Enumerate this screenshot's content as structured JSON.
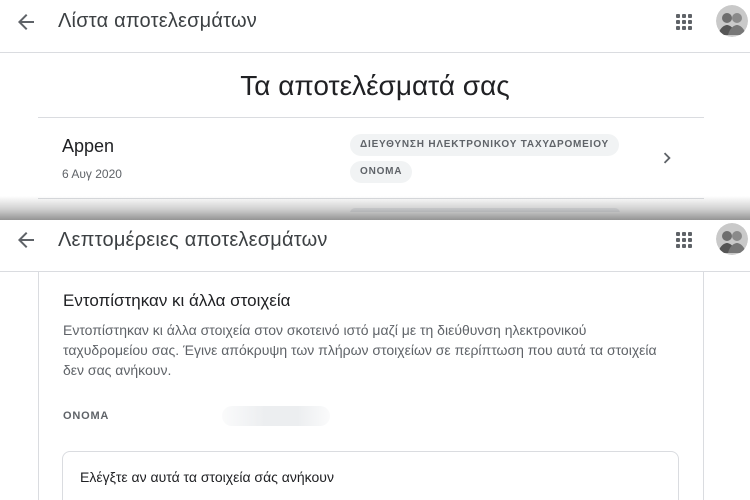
{
  "list_screen": {
    "title": "Λίστα αποτελεσμάτων",
    "heading": "Τα αποτελέσματά σας",
    "results": [
      {
        "name": "Appen",
        "date": "6 Αυγ 2020",
        "tags": [
          "ΔΙΕΥΘΥΝΣΗ ΗΛΕΚΤΡΟΝΙΚΟΥ ΤΑΧΥΔΡΟΜΕΙΟΥ",
          "ΟΝΟΜΑ"
        ]
      }
    ]
  },
  "details_screen": {
    "title": "Λεπτομέρειες αποτελεσμάτων",
    "section_title": "Εντοπίστηκαν κι άλλα στοιχεία",
    "section_description": "Εντοπίστηκαν κι άλλα στοιχεία στον σκοτεινό ιστό μαζί με τη διεύθυνση ηλεκτρονικού ταχυδρομείου σας. Έγινε απόκρυψη των πλήρων στοιχείων σε περίπτωση που αυτά τα στοιχεία δεν σας ανήκουν.",
    "field_label": "ΟΝΟΜΑ",
    "check_prompt": "Ελέγξτε αν αυτά τα στοιχεία σάς ανήκουν"
  },
  "icons": {
    "back": "arrow-back-icon",
    "apps": "apps-grid-icon",
    "chevron": "chevron-right-icon",
    "avatar": "avatar"
  },
  "colors": {
    "text_primary": "#202124",
    "text_secondary": "#5f6368",
    "divider": "#dadce0",
    "chip_bg": "#f1f3f4"
  }
}
